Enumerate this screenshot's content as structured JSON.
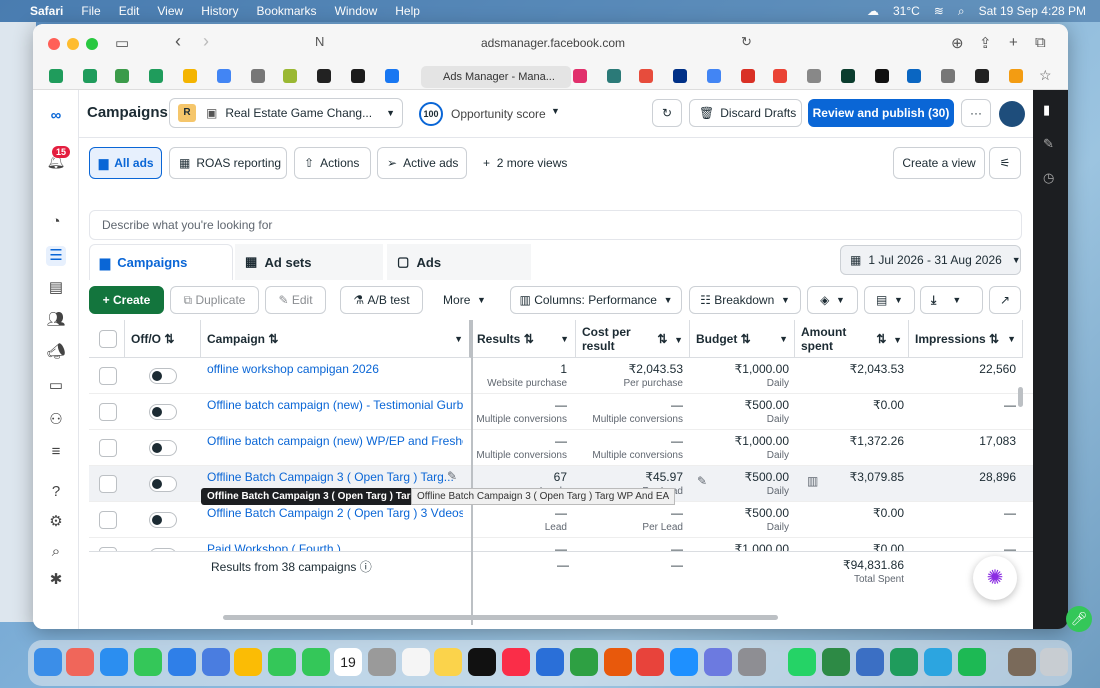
{
  "menubar": {
    "app": "Safari",
    "items": [
      "File",
      "Edit",
      "View",
      "History",
      "Bookmarks",
      "Window",
      "Help"
    ],
    "temperature": "31°C",
    "datetime": "Sat 19 Sep  4:28 PM"
  },
  "browser": {
    "url": "adsmanager.facebook.com",
    "tab_title": "Ads Manager - Mana..."
  },
  "header": {
    "title": "Campaigns",
    "account_letter": "R",
    "account_name": "Real Estate Game Chang...",
    "opportunity_score": "100",
    "opportunity_label": "Opportunity score",
    "discard": "Discard Drafts",
    "review": "Review and publish (30)"
  },
  "notifications": {
    "count": "15"
  },
  "views": {
    "all_ads": "All ads",
    "roas": "ROAS reporting",
    "actions": "Actions",
    "active_ads": "Active ads",
    "more_views": "2 more views",
    "create_view": "Create a view"
  },
  "search": {
    "placeholder": "Describe what you're looking for"
  },
  "level_tabs": {
    "campaigns": "Campaigns",
    "adsets": "Ad sets",
    "ads": "Ads"
  },
  "date_range": "1 Jul 2026 - 31 Aug 2026",
  "actions_bar": {
    "create": "Create",
    "duplicate": "Duplicate",
    "edit": "Edit",
    "ab_test": "A/B test",
    "more": "More",
    "columns": "Columns: Performance",
    "breakdown": "Breakdown"
  },
  "columns": {
    "offon": "Off/O",
    "campaign": "Campaign",
    "results": "Results",
    "cost_per_result": "Cost per result",
    "budget": "Budget",
    "amount_spent": "Amount spent",
    "impressions": "Impressions"
  },
  "rows": [
    {
      "name": "offline workshop campigan 2026",
      "results": "1",
      "results_sub": "Website purchase",
      "cpr": "₹2,043.53",
      "cpr_sub": "Per purchase",
      "budget": "₹1,000.00",
      "budget_sub": "Daily",
      "spent": "₹2,043.53",
      "impressions": "22,560"
    },
    {
      "name": "Offline batch campaign (new) - Testimonial Gurb...",
      "results": "—",
      "results_sub": "Multiple conversions",
      "cpr": "—",
      "cpr_sub": "Multiple conversions",
      "budget": "₹500.00",
      "budget_sub": "Daily",
      "spent": "₹0.00",
      "impressions": "—"
    },
    {
      "name": "Offline batch campaign (new) WP/EP and Freshers",
      "results": "—",
      "results_sub": "Multiple conversions",
      "cpr": "—",
      "cpr_sub": "Multiple conversions",
      "budget": "₹1,000.00",
      "budget_sub": "Daily",
      "spent": "₹1,372.26",
      "impressions": "17,083"
    },
    {
      "name": "Offline Batch Campaign 3 ( Open Targ ) Targ...",
      "results": "67",
      "results_sub": "Leads",
      "cpr": "₹45.97",
      "cpr_sub": "Per Lead",
      "budget": "₹500.00",
      "budget_sub": "Daily",
      "spent": "₹3,079.85",
      "impressions": "28,896"
    },
    {
      "name": "Offline Batch Campaign 2 ( Open Targ ) 3 Vdeos",
      "results": "—",
      "results_sub": "Lead",
      "cpr": "—",
      "cpr_sub": "Per Lead",
      "budget": "₹500.00",
      "budget_sub": "Daily",
      "spent": "₹0.00",
      "impressions": "—"
    },
    {
      "name": "Paid Workshop ( Fourth )",
      "results": "—",
      "results_sub": "",
      "cpr": "—",
      "cpr_sub": "",
      "budget": "₹1,000.00",
      "budget_sub": "",
      "spent": "₹0.00",
      "impressions": "—"
    }
  ],
  "tooltip_dark": "Offline Batch Campaign 3 ( Open Targ ) Targ WP",
  "tooltip_light": "Offline Batch Campaign 3 ( Open Targ ) Targ WP And EA",
  "summary": {
    "label": "Results from 38 campaigns",
    "results": "—",
    "cpr": "—",
    "spent": "₹94,831.86",
    "spent_sub": "Total Spent"
  },
  "dock": {
    "calendar_day": "19"
  }
}
